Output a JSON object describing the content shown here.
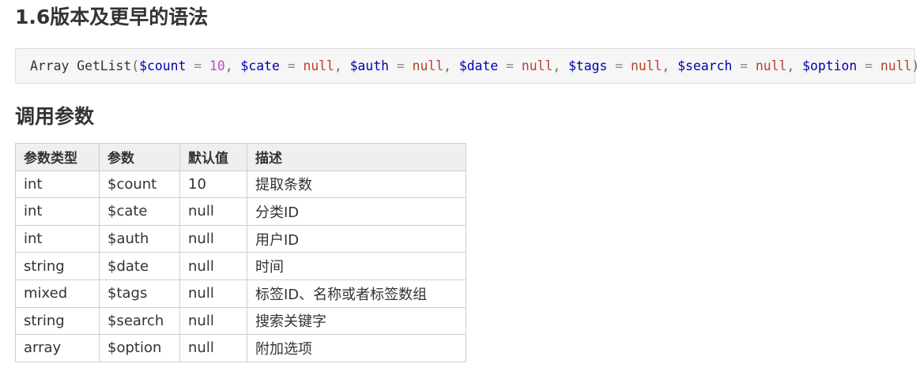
{
  "section1": {
    "title": "1.6版本及更早的语法"
  },
  "code": {
    "tokens": [
      {
        "t": "Array GetList",
        "k": "plain"
      },
      {
        "t": "(",
        "k": "punc"
      },
      {
        "t": "$count",
        "k": "var"
      },
      {
        "t": " = ",
        "k": "op"
      },
      {
        "t": "10",
        "k": "num"
      },
      {
        "t": ", ",
        "k": "punc"
      },
      {
        "t": "$cate",
        "k": "var"
      },
      {
        "t": " = ",
        "k": "op"
      },
      {
        "t": "null",
        "k": "null"
      },
      {
        "t": ", ",
        "k": "punc"
      },
      {
        "t": "$auth",
        "k": "var"
      },
      {
        "t": " = ",
        "k": "op"
      },
      {
        "t": "null",
        "k": "null"
      },
      {
        "t": ", ",
        "k": "punc"
      },
      {
        "t": "$date",
        "k": "var"
      },
      {
        "t": " = ",
        "k": "op"
      },
      {
        "t": "null",
        "k": "null"
      },
      {
        "t": ", ",
        "k": "punc"
      },
      {
        "t": "$tags",
        "k": "var"
      },
      {
        "t": " = ",
        "k": "op"
      },
      {
        "t": "null",
        "k": "null"
      },
      {
        "t": ", ",
        "k": "punc"
      },
      {
        "t": "$search",
        "k": "var"
      },
      {
        "t": " = ",
        "k": "op"
      },
      {
        "t": "null",
        "k": "null"
      },
      {
        "t": ", ",
        "k": "punc"
      },
      {
        "t": "$option",
        "k": "var"
      },
      {
        "t": " = ",
        "k": "op"
      },
      {
        "t": "null",
        "k": "null"
      },
      {
        "t": ")",
        "k": "punc"
      }
    ]
  },
  "section2": {
    "title": "调用参数"
  },
  "params_table": {
    "headers": [
      "参数类型",
      "参数",
      "默认值",
      "描述"
    ],
    "rows": [
      [
        "int",
        "$count",
        "10",
        "提取条数"
      ],
      [
        "int",
        "$cate",
        "null",
        "分类ID"
      ],
      [
        "int",
        "$auth",
        "null",
        "用户ID"
      ],
      [
        "string",
        "$date",
        "null",
        "时间"
      ],
      [
        "mixed",
        "$tags",
        "null",
        "标签ID、名称或者标签数组"
      ],
      [
        "string",
        "$search",
        "null",
        "搜索关键字"
      ],
      [
        "array",
        "$option",
        "null",
        "附加选项"
      ]
    ]
  }
}
